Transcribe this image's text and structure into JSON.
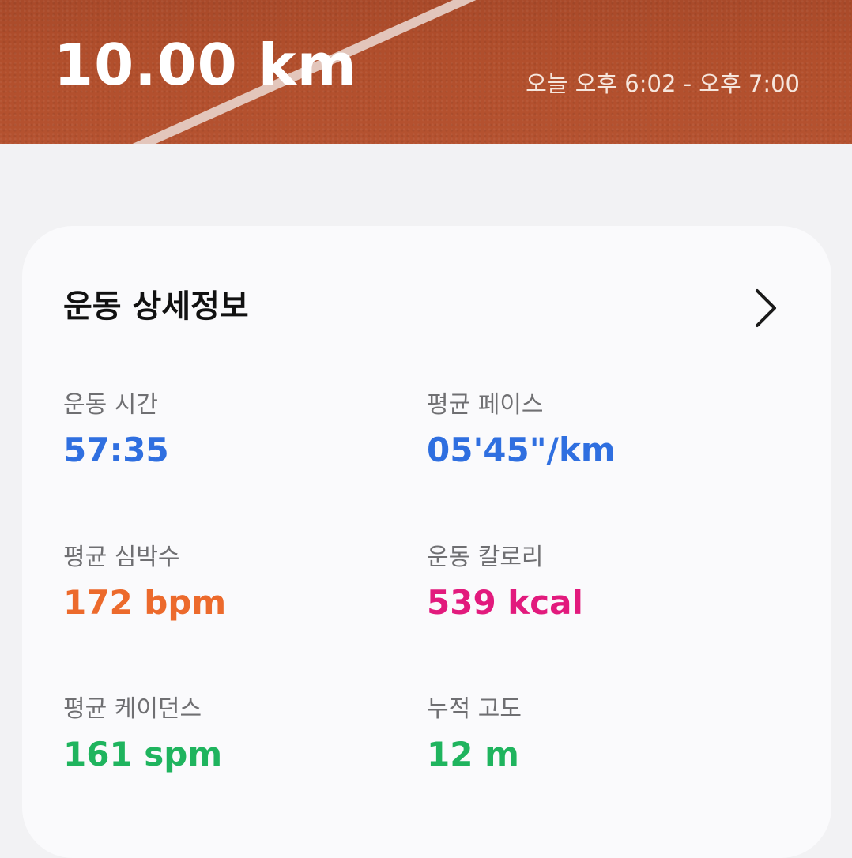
{
  "header": {
    "distance": "10.00 km",
    "time_range": "오늘 오후 6:02 - 오후 7:00"
  },
  "card": {
    "title": "운동 상세정보"
  },
  "stats": [
    {
      "label": "운동 시간",
      "value": "57:35",
      "color": "#2f6fe0"
    },
    {
      "label": "평균 페이스",
      "value": "05'45\"/km",
      "color": "#2f6fe0"
    },
    {
      "label": "평균 심박수",
      "value": "172 bpm",
      "color": "#ec6a2c"
    },
    {
      "label": "운동 칼로리",
      "value": "539 kcal",
      "color": "#e21a7d"
    },
    {
      "label": "평균 케이던스",
      "value": "161 spm",
      "color": "#1fb45e"
    },
    {
      "label": "누적 고도",
      "value": "12 m",
      "color": "#1fb45e"
    }
  ],
  "icons": {
    "detail_arrow": "chevron-right-icon"
  }
}
